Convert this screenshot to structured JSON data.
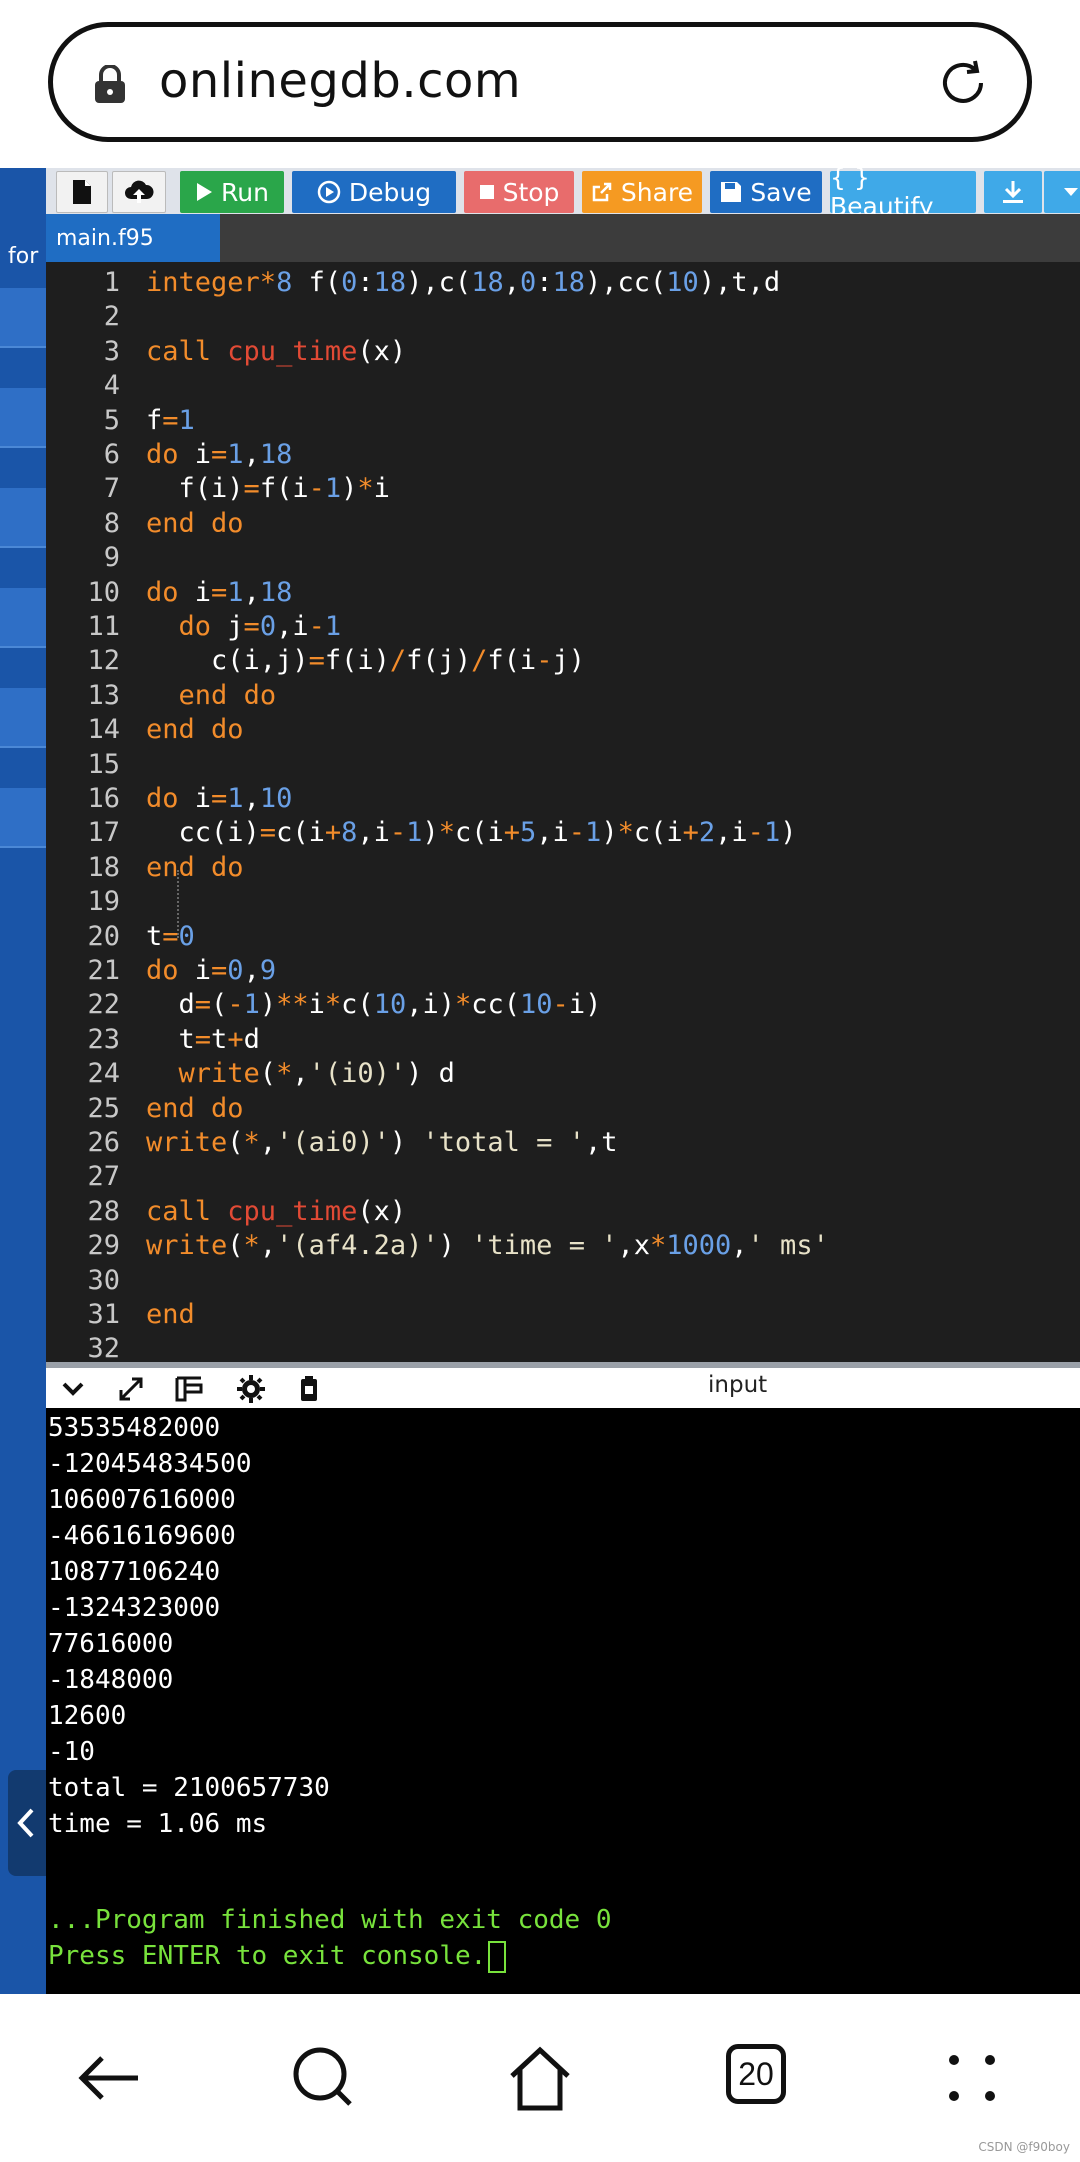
{
  "browser": {
    "url": "onlinegdb.com"
  },
  "sidebar": {
    "label": "for"
  },
  "toolbar": {
    "run_label": "Run",
    "debug_label": "Debug",
    "stop_label": "Stop",
    "share_label": "Share",
    "save_label": "Save",
    "beautify_label": "{ } Beautify"
  },
  "editor": {
    "tab_label": "main.f95",
    "lines": [
      "integer*8 f(0:18),c(18,0:18),cc(10),t,d",
      "",
      "call cpu_time(x)",
      "",
      "f=1",
      "do i=1,18",
      "  f(i)=f(i-1)*i",
      "end do",
      "",
      "do i=1,18",
      "  do j=0,i-1",
      "    c(i,j)=f(i)/f(j)/f(i-j)",
      "  end do",
      "end do",
      "",
      "do i=1,10",
      "  cc(i)=c(i+8,i-1)*c(i+5,i-1)*c(i+2,i-1)",
      "end do",
      "",
      "t=0",
      "do i=0,9",
      "  d=(-1)**i*c(10,i)*cc(10-i)",
      "  t=t+d",
      "  write(*,'(i0)') d",
      "end do",
      "write(*,'(ai0)') 'total = ',t",
      "",
      "call cpu_time(x)",
      "write(*,'(af4.2a)') 'time = ',x*1000,' ms'",
      "",
      "end",
      ""
    ]
  },
  "output_panel": {
    "input_label": "input",
    "lines": [
      "53535482000",
      "-120454834500",
      "106007616000",
      "-46616169600",
      "10877106240",
      "-1324323000",
      "77616000",
      "-1848000",
      "12600",
      "-10",
      "total = 2100657730",
      "time = 1.06 ms"
    ],
    "finish_line": "...Program finished with exit code 0",
    "press_line": "Press ENTER to exit console."
  },
  "navbar": {
    "tab_count": "20"
  },
  "watermark": "CSDN @f90boy",
  "colors": {
    "run": "#2aa64a",
    "debug": "#1f6dc3",
    "stop": "#e86c6c",
    "share": "#f59a22",
    "beautify": "#3fa9e8",
    "keyword": "#f28c2b",
    "function": "#e24a35",
    "number": "#6aa0e6",
    "console_green": "#78e23c"
  }
}
